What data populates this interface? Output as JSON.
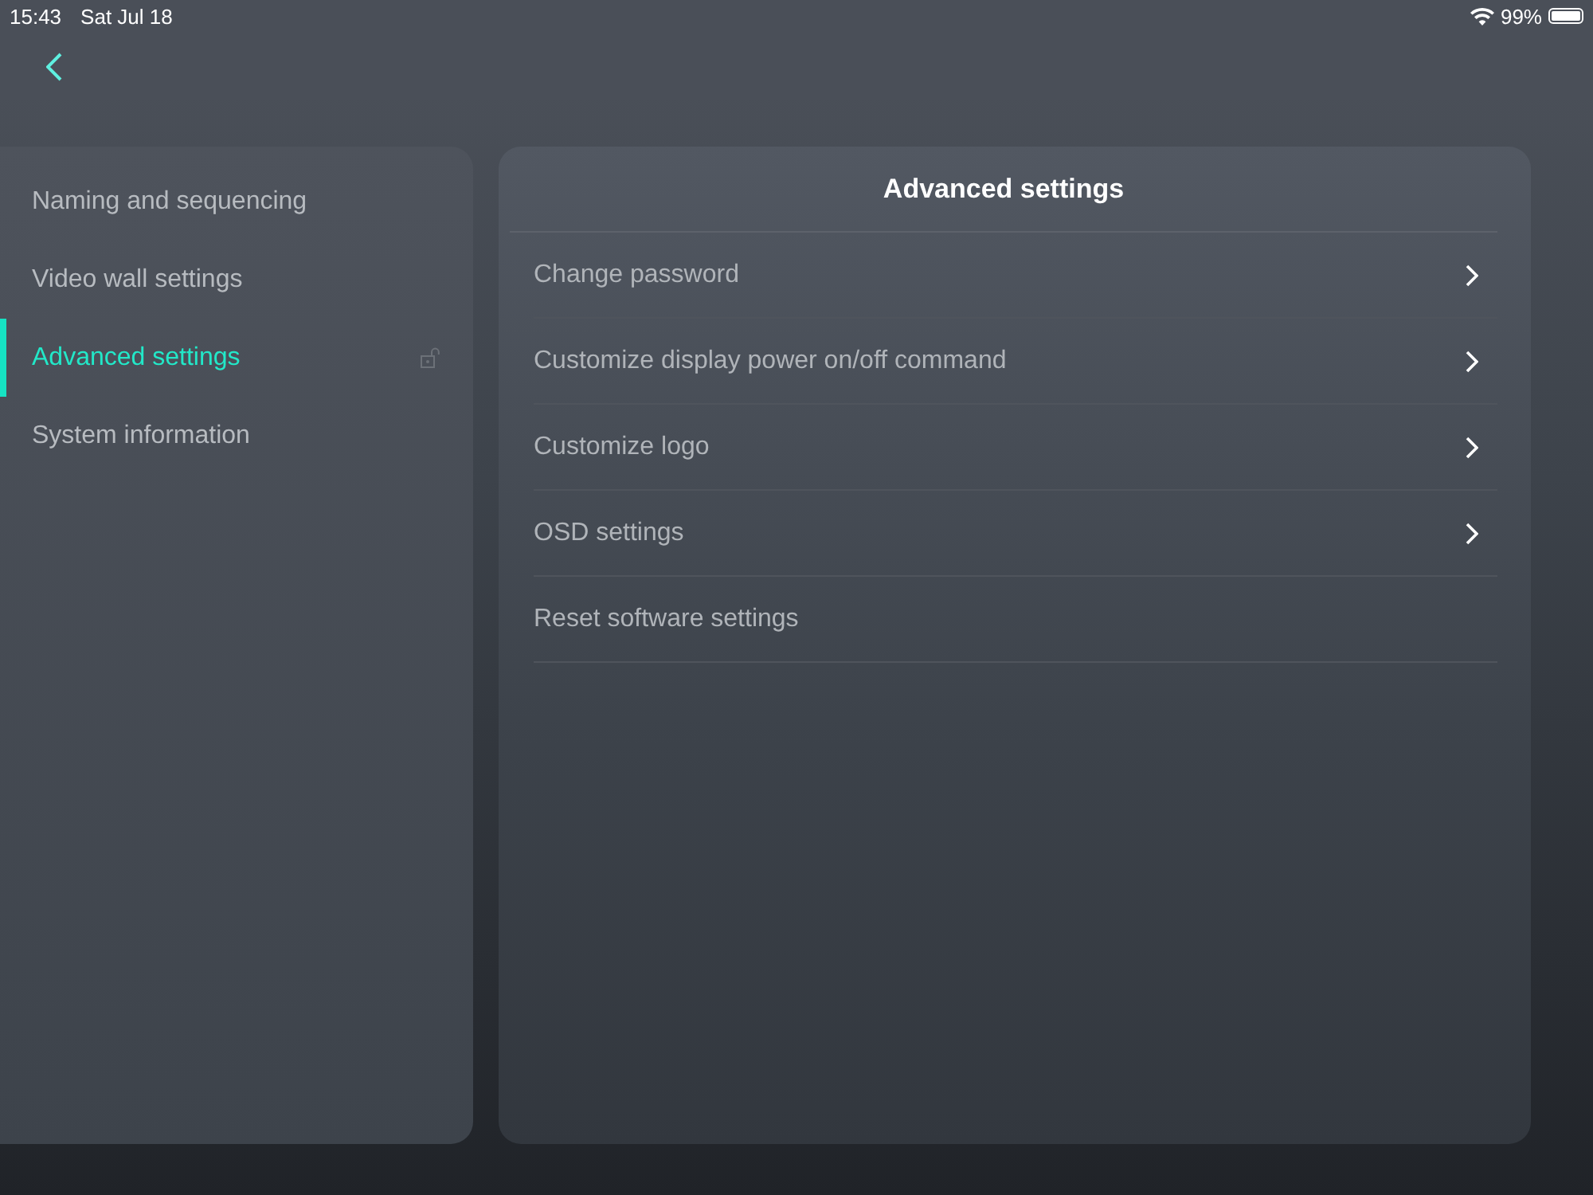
{
  "status_bar": {
    "time": "15:43",
    "date": "Sat Jul 18",
    "battery": "99%"
  },
  "sidebar": {
    "items": [
      {
        "label": "Naming and sequencing",
        "selected": false,
        "unlocked": false
      },
      {
        "label": "Video wall settings",
        "selected": false,
        "unlocked": false
      },
      {
        "label": "Advanced settings",
        "selected": true,
        "unlocked": true
      },
      {
        "label": "System information",
        "selected": false,
        "unlocked": false
      }
    ]
  },
  "panel": {
    "title": "Advanced settings",
    "rows": [
      {
        "label": "Change password",
        "kind": "link"
      },
      {
        "label": "Customize display power on/off command",
        "kind": "link"
      },
      {
        "label": "Customize logo",
        "kind": "link"
      },
      {
        "label": "OSD settings",
        "kind": "link"
      },
      {
        "label": "Reset software settings",
        "kind": "action"
      }
    ]
  }
}
